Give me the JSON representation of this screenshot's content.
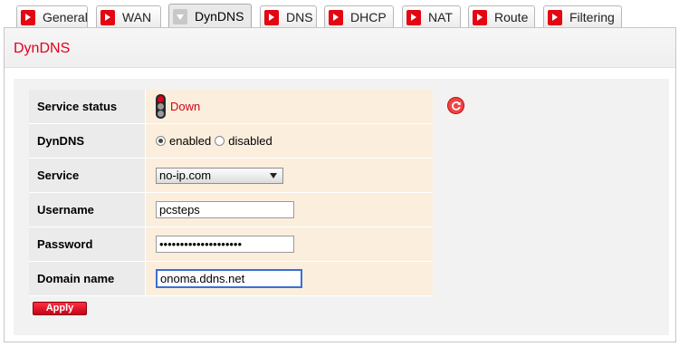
{
  "tabs": [
    {
      "label": "General"
    },
    {
      "label": "WAN"
    },
    {
      "label": "DynDNS"
    },
    {
      "label": "DNS"
    },
    {
      "label": "DHCP"
    },
    {
      "label": "NAT"
    },
    {
      "label": "Route"
    },
    {
      "label": "Filtering"
    }
  ],
  "active_tab": "DynDNS",
  "page_title": "DynDNS",
  "form": {
    "service_status": {
      "label": "Service status",
      "value": "Down",
      "status_icon": "traffic-light-icon",
      "status_color": "#e2001a"
    },
    "dyndns": {
      "label": "DynDNS",
      "options": [
        "enabled",
        "disabled"
      ],
      "selected": "enabled"
    },
    "service": {
      "label": "Service",
      "value": "no-ip.com"
    },
    "username": {
      "label": "Username",
      "value": "pcsteps"
    },
    "password": {
      "label": "Password",
      "value": "••••••••••••••••••••"
    },
    "domain_name": {
      "label": "Domain name",
      "value": "onoma.ddns.net"
    }
  },
  "refresh_icon": "refresh-icon",
  "apply_label": "Apply",
  "colors": {
    "accent": "#e2001a",
    "value_bg": "#fbeedd",
    "label_bg": "#ebebeb"
  }
}
